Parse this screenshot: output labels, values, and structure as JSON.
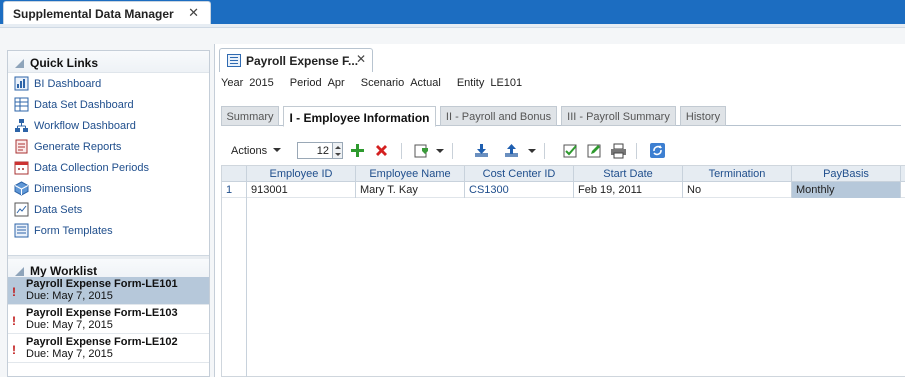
{
  "app": {
    "tab_title": "Supplemental Data Manager",
    "tab_close": "✕"
  },
  "quick_links": {
    "title": "Quick Links",
    "items": [
      {
        "label": "BI Dashboard",
        "icon": "bi-dashboard-icon"
      },
      {
        "label": "Data Set Dashboard",
        "icon": "data-set-dashboard-icon"
      },
      {
        "label": "Workflow Dashboard",
        "icon": "workflow-icon"
      },
      {
        "label": "Generate Reports",
        "icon": "reports-icon"
      },
      {
        "label": "Data Collection Periods",
        "icon": "calendar-icon"
      },
      {
        "label": "Dimensions",
        "icon": "cube-icon"
      },
      {
        "label": "Data Sets",
        "icon": "data-sets-icon"
      },
      {
        "label": "Form Templates",
        "icon": "form-template-icon"
      }
    ]
  },
  "worklist": {
    "title": "My Worklist",
    "items": [
      {
        "title": "Payroll Expense Form-LE101",
        "due": "Due: May 7, 2015",
        "selected": true
      },
      {
        "title": "Payroll Expense Form-LE103",
        "due": "Due: May 7, 2015",
        "selected": false
      },
      {
        "title": "Payroll Expense Form-LE102",
        "due": "Due: May 7, 2015",
        "selected": false
      }
    ],
    "alert_glyph": "!"
  },
  "document": {
    "tab_title": "Payroll Expense F...",
    "tab_close": "✕",
    "pov": [
      {
        "label": "Year",
        "value": "2015"
      },
      {
        "label": "Period",
        "value": "Apr"
      },
      {
        "label": "Scenario",
        "value": "Actual"
      },
      {
        "label": "Entity",
        "value": "LE101"
      }
    ],
    "tabs": [
      {
        "label": "Summary",
        "active": false
      },
      {
        "label": "I - Employee Information",
        "active": true
      },
      {
        "label": "II - Payroll and Bonus",
        "active": false
      },
      {
        "label": "III - Payroll Summary",
        "active": false
      },
      {
        "label": "History",
        "active": false
      }
    ]
  },
  "toolbar": {
    "actions_label": "Actions",
    "rows_value": "12",
    "icons": [
      "add-row-icon",
      "delete-row-icon",
      "import-icon",
      "download-icon",
      "upload-icon",
      "validate-icon",
      "edit-icon",
      "print-icon",
      "refresh-icon"
    ]
  },
  "grid": {
    "columns": [
      "Employee ID",
      "Employee Name",
      "Cost Center ID",
      "Start Date",
      "Termination",
      "PayBasis"
    ],
    "rows": [
      {
        "num": "1",
        "cells": [
          "913001",
          "Mary T. Kay",
          "CS1300",
          "Feb 19, 2011",
          "No",
          "Monthly"
        ]
      }
    ]
  },
  "colors": {
    "brand_bar": "#1c6dc1",
    "selection": "#b6c8da",
    "link": "#1f4e8c",
    "alert": "#c01818"
  }
}
